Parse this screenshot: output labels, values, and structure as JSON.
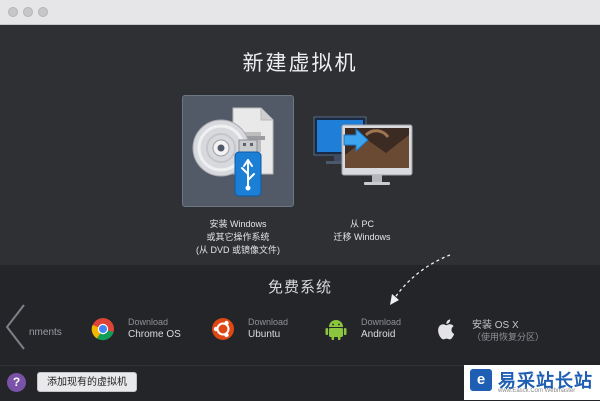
{
  "window": {
    "title": "新建虚拟机"
  },
  "options": [
    {
      "lines": [
        "安装 Windows",
        "或其它操作系统",
        "(从 DVD 或镜像文件)"
      ],
      "icon": "dvd-usb-icon",
      "selected": true
    },
    {
      "lines": [
        "从 PC",
        "迁移 Windows"
      ],
      "icon": "pc-migrate-icon",
      "selected": false
    }
  ],
  "free_systems": {
    "heading": "免费系统",
    "partial_item": "nments",
    "items": [
      {
        "line1": "Download",
        "line2": "Chrome OS",
        "icon": "chrome-icon"
      },
      {
        "line1": "Download",
        "line2": "Ubuntu",
        "icon": "ubuntu-icon"
      },
      {
        "line1": "Download",
        "line2": "Android",
        "icon": "android-icon"
      },
      {
        "line1": "安装 OS X",
        "line2": "（使用恢复分区）",
        "icon": "apple-icon"
      }
    ]
  },
  "footer": {
    "help": "?",
    "add_existing": "添加现有的虚拟机"
  },
  "watermark": {
    "logo": "e",
    "text": "易采站长站",
    "url": "www.Easck.Com Webmaster"
  },
  "colors": {
    "background": "#2e3034",
    "selected_card": "#515a66",
    "help_button": "#7a52a7",
    "watermark_blue": "#1f5fb3"
  }
}
